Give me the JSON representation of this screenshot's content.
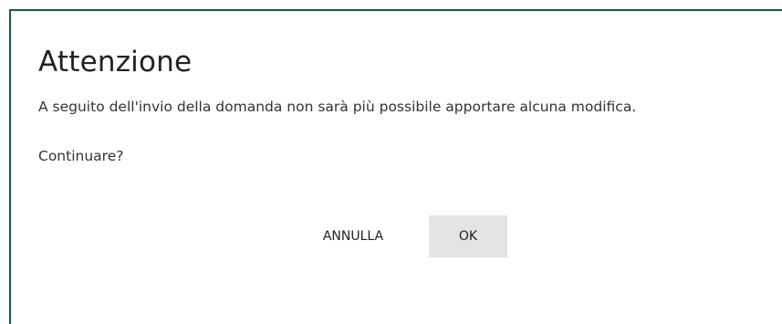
{
  "dialog": {
    "title": "Attenzione",
    "message": "A seguito dell'invio della domanda non sarà più possibile apportare alcuna modifica.",
    "question": "Continuare?",
    "buttons": {
      "cancel_label": "ANNULLA",
      "ok_label": "OK"
    }
  },
  "colors": {
    "border": "#1e5a3a",
    "ok_button_bg": "#e4e4e4",
    "text": "#333333"
  }
}
